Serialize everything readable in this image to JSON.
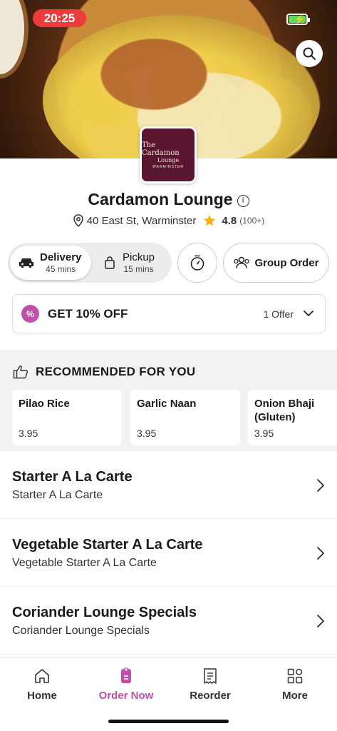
{
  "status_bar": {
    "time": "20:25"
  },
  "restaurant": {
    "logo": {
      "line1": "The Cardamon",
      "line2": "Lounge",
      "line3": "WARMINSTER"
    },
    "name": "Cardamon Lounge",
    "address": "40 East St, Warminster",
    "rating": "4.8",
    "rating_count": "(100+)"
  },
  "order_mode": {
    "delivery": {
      "label": "Delivery",
      "time": "45 mins"
    },
    "pickup": {
      "label": "Pickup",
      "time": "15 mins"
    },
    "group_order": "Group Order"
  },
  "offer": {
    "badge": "%",
    "title": "GET 10% OFF",
    "count": "1 Offer"
  },
  "recommended": {
    "heading": "RECOMMENDED FOR YOU",
    "items": [
      {
        "name": "Pilao Rice",
        "price": "3.95"
      },
      {
        "name": "Garlic Naan",
        "price": "3.95"
      },
      {
        "name": "Onion Bhaji (Gluten)",
        "price": "3.95"
      }
    ]
  },
  "categories": [
    {
      "title": "Starter A La Carte",
      "subtitle": "Starter A La Carte"
    },
    {
      "title": "Vegetable Starter A La Carte",
      "subtitle": "Vegetable Starter A La Carte"
    },
    {
      "title": "Coriander Lounge Specials",
      "subtitle": "Coriander Lounge Specials"
    }
  ],
  "bottom_nav": [
    {
      "label": "Home",
      "icon": "home-icon"
    },
    {
      "label": "Order Now",
      "icon": "order-icon",
      "active": true
    },
    {
      "label": "Reorder",
      "icon": "receipt-icon"
    },
    {
      "label": "More",
      "icon": "grid-icon"
    }
  ],
  "colors": {
    "accent": "#c24fa8",
    "status_red": "#ec3b3b",
    "star": "#f5b300",
    "logo_bg": "#5a1530"
  }
}
